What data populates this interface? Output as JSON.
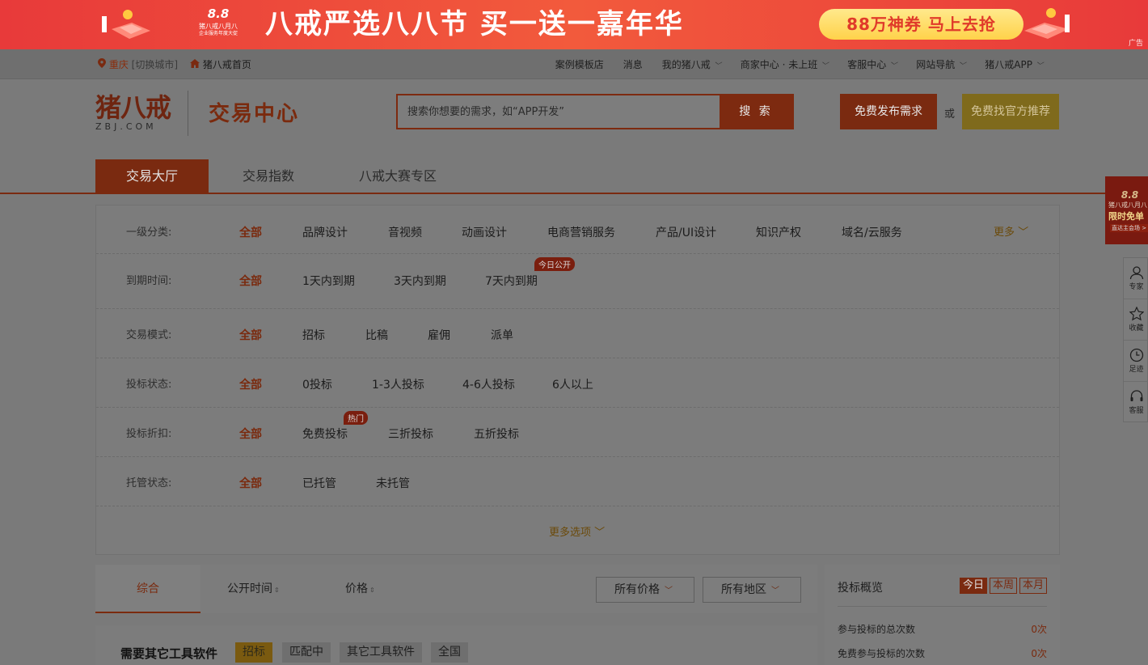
{
  "banner": {
    "logo_num": "8.8",
    "logo_line1": "猪八戒八月八",
    "logo_line2": "企业服务年度大促",
    "headline": "八戒严选八八节 买一送一嘉年华",
    "cta": "88万神券  马上去抢",
    "ad_label": "广告"
  },
  "topnav": {
    "city": "重庆",
    "switch_city": "[切换城市]",
    "home": "猪八戒首页",
    "links": [
      "案例模板店",
      "消息",
      "我的猪八戒",
      "商家中心 · 未上班",
      "客服中心",
      "网站导航",
      "猪八戒APP"
    ]
  },
  "header": {
    "logo_cn": "猪八戒",
    "logo_en": "ZBJ.COM",
    "title": "交易中心",
    "search_placeholder": "搜索你想要的需求，如“APP开发”",
    "search_button": "搜 索",
    "publish_button": "免费发布需求",
    "or": "或",
    "recommend_button": "免费找官方推荐"
  },
  "tabs": [
    "交易大厅",
    "交易指数",
    "八戒大赛专区"
  ],
  "filters": {
    "category": {
      "label": "一级分类:",
      "options": [
        "全部",
        "品牌设计",
        "音视频",
        "动画设计",
        "电商营销服务",
        "产品/UI设计",
        "知识产权",
        "域名/云服务"
      ],
      "more": "更多"
    },
    "deadline": {
      "label": "到期时间:",
      "options": [
        "全部",
        "1天内到期",
        "3天内到期",
        "7天内到期"
      ],
      "tag": "今日公开"
    },
    "mode": {
      "label": "交易模式:",
      "options": [
        "全部",
        "招标",
        "比稿",
        "雇佣",
        "派单"
      ]
    },
    "bid_status": {
      "label": "投标状态:",
      "options": [
        "全部",
        "0投标",
        "1-3人投标",
        "4-6人投标",
        "6人以上"
      ]
    },
    "bid_discount": {
      "label": "投标折扣:",
      "options": [
        "全部",
        "免费投标",
        "三折投标",
        "五折投标"
      ],
      "tag": "热门"
    },
    "escrow": {
      "label": "托管状态:",
      "options": [
        "全部",
        "已托管",
        "未托管"
      ]
    },
    "more_options": "更多选项"
  },
  "sortbar": {
    "comprehensive": "综合",
    "publish_time": "公开时间",
    "price": "价格",
    "all_prices": "所有价格",
    "all_regions": "所有地区"
  },
  "listing": {
    "title": "需要其它工具软件",
    "badges": [
      "招标",
      "匹配中",
      "其它工具软件",
      "全国"
    ]
  },
  "overview": {
    "title": "投标概览",
    "periods": [
      "今日",
      "本周",
      "本月"
    ],
    "stats": [
      {
        "label": "参与投标的总次数",
        "value": "0次"
      },
      {
        "label": "免费参与投标的次数",
        "value": "0次"
      }
    ]
  },
  "sidepromo": {
    "num": "8.8",
    "line1": "猪八戒八月八",
    "line2": "限时免单",
    "line3": "直达主会场 >"
  },
  "sidebar": [
    "专家",
    "收藏",
    "足迹",
    "客服"
  ]
}
